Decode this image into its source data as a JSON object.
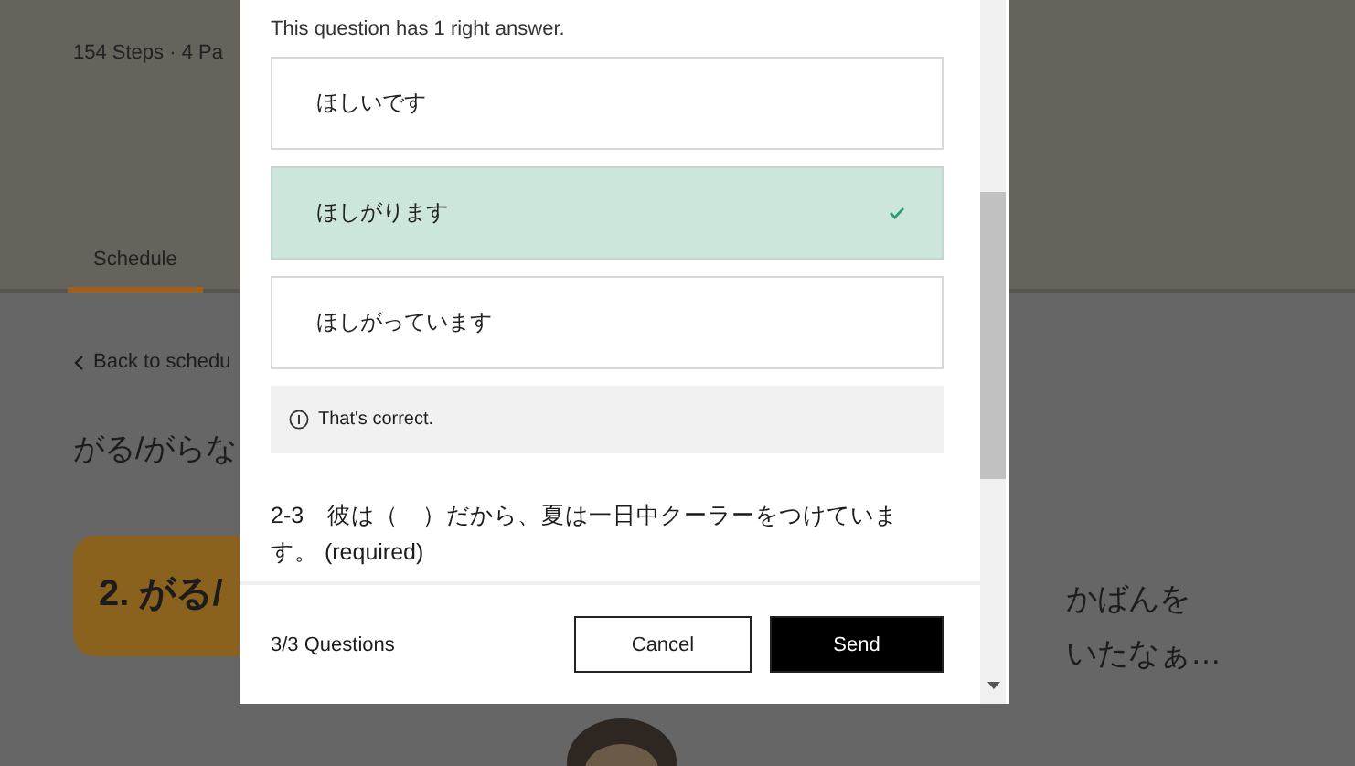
{
  "background": {
    "meta": "154 Steps · 4 Pa",
    "tabs": [
      {
        "label": "Schedule",
        "selected": true
      }
    ],
    "back_link": "Back to schedu",
    "heading": "がる/がらな",
    "lesson_badge": "2. がる/",
    "speech_lines": [
      "かばんを",
      "いたなぁ…"
    ]
  },
  "dialog": {
    "instruction": "This question has 1 right answer.",
    "options": [
      {
        "text": "ほしいです",
        "selected": false
      },
      {
        "text": "ほしがります",
        "selected": true
      },
      {
        "text": "ほしがっています",
        "selected": false
      }
    ],
    "feedback": "That's correct.",
    "next_question": "2-3　彼は（　）だから、夏は一日中クーラーをつけています。 (required)",
    "progress": "3/3 Questions",
    "buttons": [
      {
        "label": "Cancel",
        "kind": "secondary"
      },
      {
        "label": "Send",
        "kind": "primary"
      }
    ]
  }
}
